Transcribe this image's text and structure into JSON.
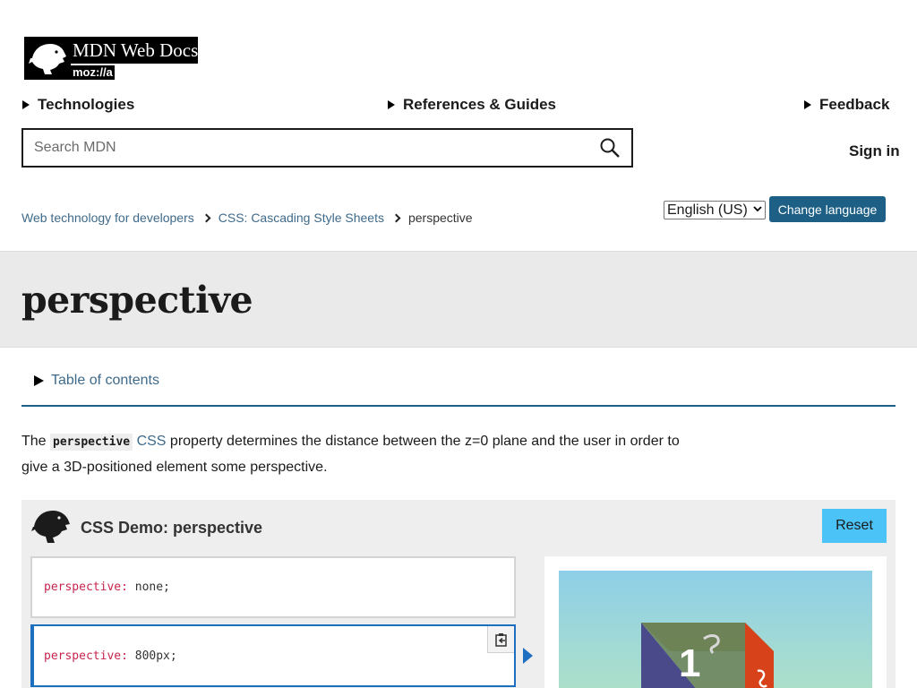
{
  "logo": {
    "title": "MDN Web Docs",
    "subtitle": "moz://a"
  },
  "nav": {
    "technologies": "Technologies",
    "references": "References & Guides",
    "feedback": "Feedback"
  },
  "search": {
    "placeholder": "Search MDN",
    "value": ""
  },
  "signin": "Sign in",
  "language": {
    "selected": "English (US)",
    "button": "Change language"
  },
  "breadcrumb": {
    "items": [
      "Web technology for developers",
      "CSS: Cascading Style Sheets"
    ],
    "current": "perspective"
  },
  "page": {
    "title": "perspective"
  },
  "toc": {
    "label": "Table of contents"
  },
  "description": {
    "before": "The ",
    "code": "perspective",
    "link": "CSS",
    "after": " property determines the distance between the z=0 plane and the user in order to give a 3D-positioned element some perspective."
  },
  "demo": {
    "title": "CSS Demo: perspective",
    "reset": "Reset",
    "choices": [
      {
        "property": "perspective:",
        "value": " none;"
      },
      {
        "property": "perspective:",
        "value": " 800px;"
      }
    ],
    "cube_face_label": "1"
  },
  "colors": {
    "link": "#3f6a8a",
    "button_primary": "#1e6085",
    "reset_button": "#4cc3f7",
    "selected_choice_border": "#1e6fbf"
  }
}
